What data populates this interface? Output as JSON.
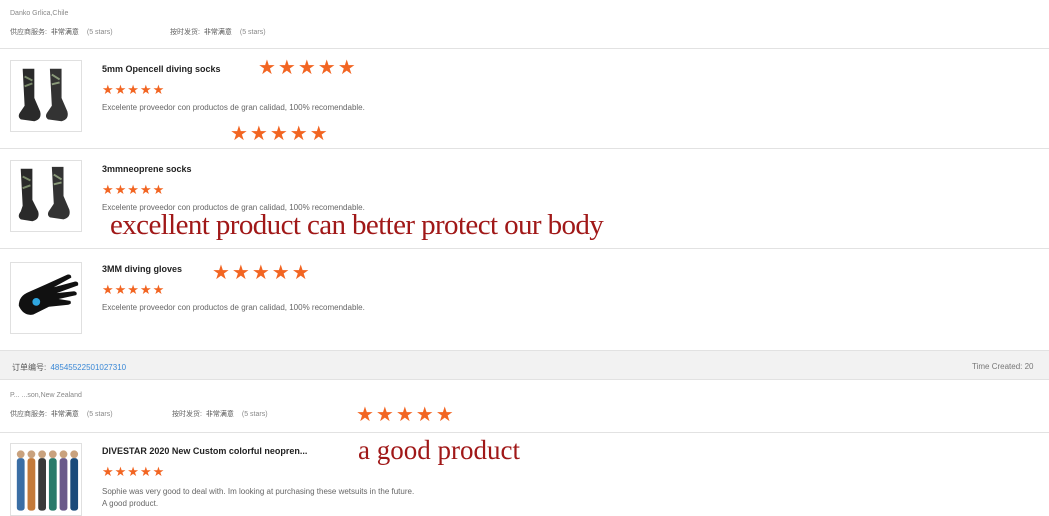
{
  "feedback1": {
    "buyer": "Danko Grlica,Chile",
    "supplier_service_label": "供应商服务:",
    "supplier_service_value": "非常满意",
    "supplier_service_note": "(5 stars)",
    "ontime_label": "按时发货:",
    "ontime_value": "非常满意",
    "ontime_note": "(5 stars)"
  },
  "items": [
    {
      "title": "5mm Opencell diving socks",
      "stars": "★★★★★",
      "review": "Excelente proveedor con productos de gran calidad, 100% recomendable.",
      "icon": "socks-icon"
    },
    {
      "title": "3mmneoprene socks",
      "stars": "★★★★★",
      "review": "Excelente proveedor con productos de gran calidad, 100% recomendable.",
      "icon": "socks-icon"
    },
    {
      "title": "3MM diving gloves",
      "stars": "★★★★★",
      "review": "Excelente proveedor con productos de gran calidad, 100% recomendable.",
      "icon": "glove-icon"
    }
  ],
  "overlays": {
    "stars_big": "★★★★★",
    "caption1": "excellent product can better protect our body",
    "caption2": "a good product"
  },
  "order": {
    "label": "订单编号:",
    "number": "48545522501027310",
    "time_created": "Time Created: 20"
  },
  "feedback2": {
    "buyer": "P... ...son,New Zealand",
    "supplier_service_label": "供应商服务:",
    "supplier_service_value": "非常满意",
    "supplier_service_note": "(5 stars)",
    "ontime_label": "按时发货:",
    "ontime_value": "非常满意",
    "ontime_note": "(5 stars)",
    "item": {
      "title": "DIVESTAR 2020 New Custom colorful neopren...",
      "stars": "★★★★★",
      "review_line1": "Sophie was very good to deal with. Im looking at purchasing these wetsuits in the future.",
      "review_line2": "A good product.",
      "icon": "wetsuits-icon"
    }
  },
  "colors": {
    "star": "#f26522",
    "overlay_text": "#a01818",
    "link": "#3a88d6"
  }
}
